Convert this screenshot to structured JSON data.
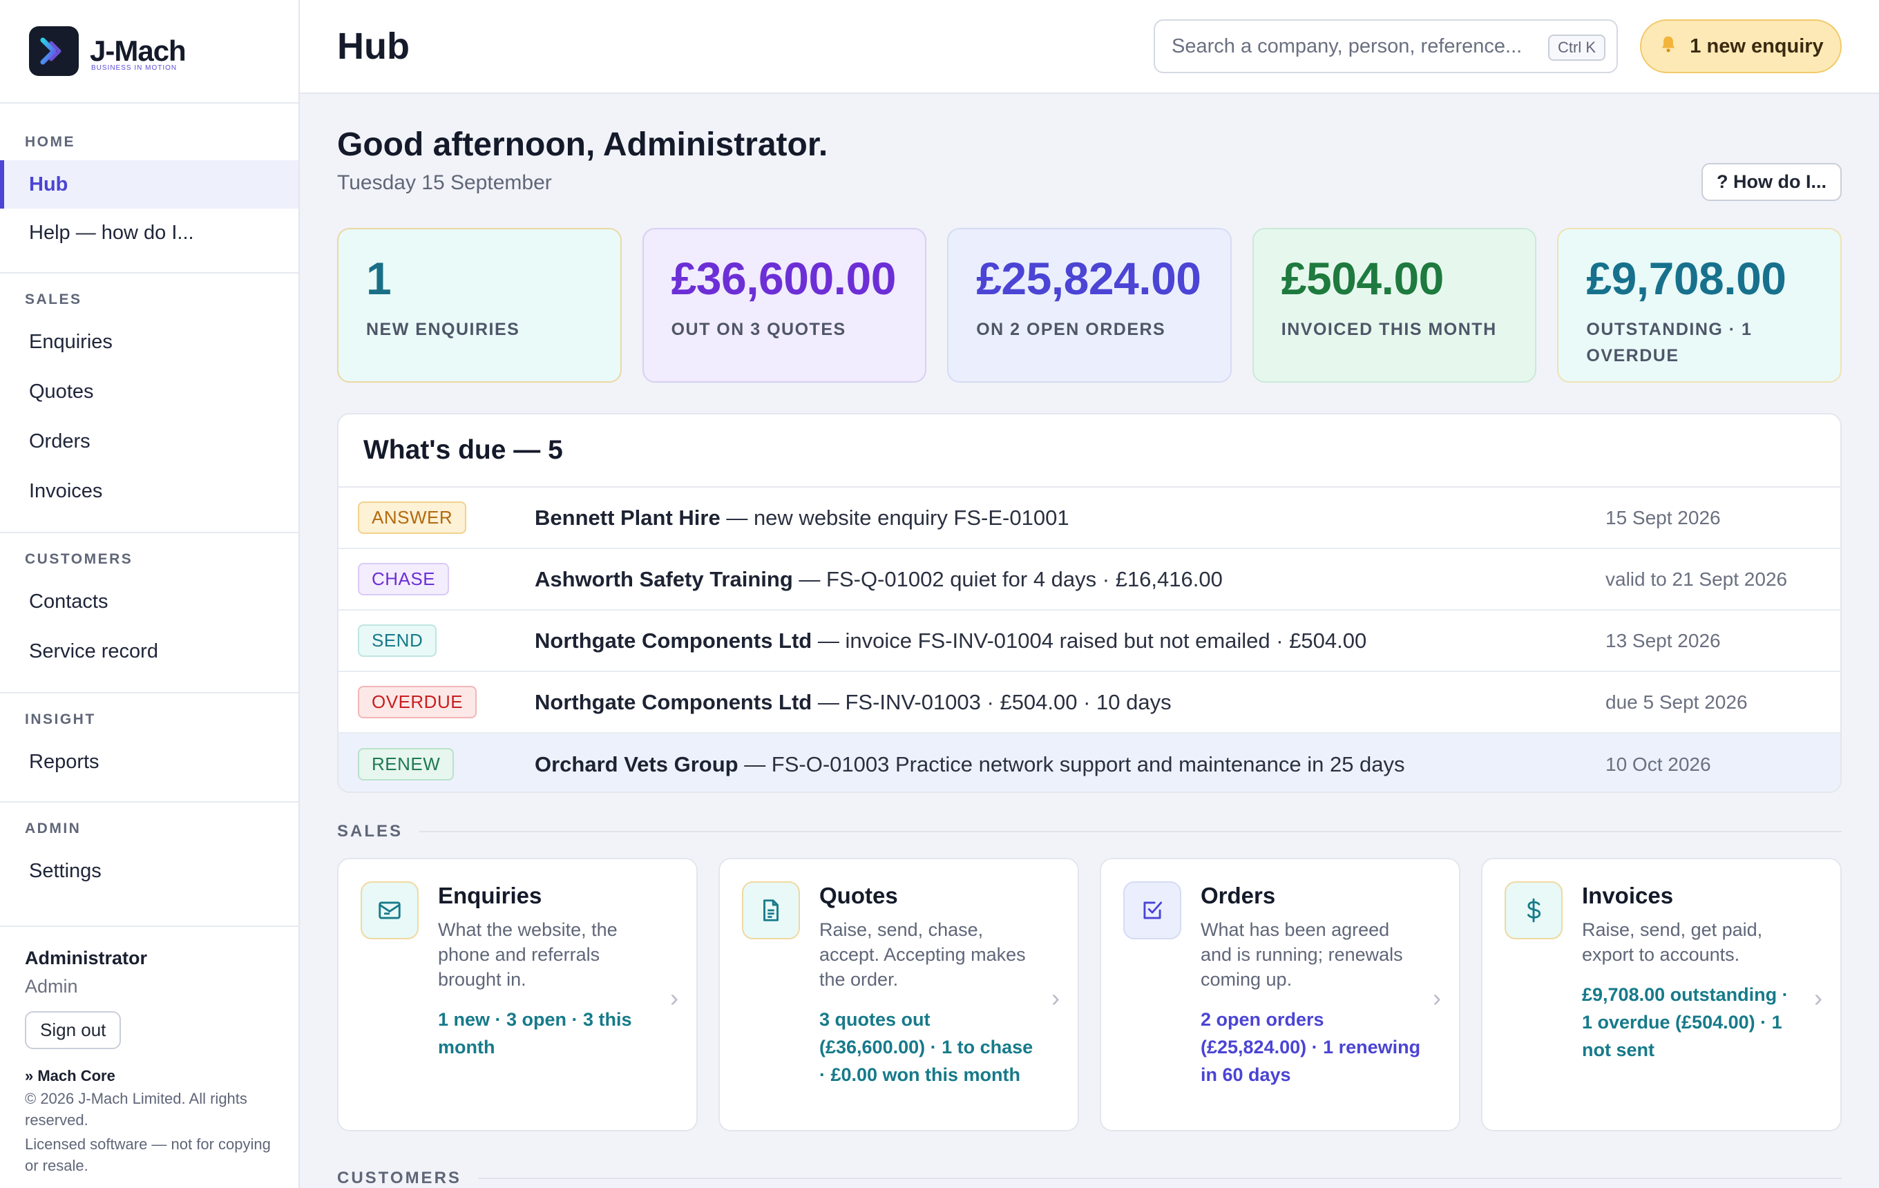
{
  "brand": {
    "name": "J-Mach",
    "tagline": "BUSINESS IN MOTION"
  },
  "sidebar": {
    "sections": [
      {
        "heading": "HOME",
        "items": [
          "Hub",
          "Help — how do I..."
        ]
      },
      {
        "heading": "SALES",
        "items": [
          "Enquiries",
          "Quotes",
          "Orders",
          "Invoices"
        ]
      },
      {
        "heading": "CUSTOMERS",
        "items": [
          "Contacts",
          "Service record"
        ]
      },
      {
        "heading": "INSIGHT",
        "items": [
          "Reports"
        ]
      },
      {
        "heading": "ADMIN",
        "items": [
          "Settings"
        ]
      }
    ],
    "active": "Hub"
  },
  "user": {
    "name": "Administrator",
    "role": "Admin",
    "signout_label": "Sign out",
    "product": "» Mach Core",
    "legal_1": "© 2026 J-Mach Limited. All rights reserved.",
    "legal_2": "Licensed software — not for copying or resale."
  },
  "header": {
    "title": "Hub",
    "search_placeholder": "Search a company, person, reference...",
    "search_shortcut": "Ctrl K",
    "alert_label": "1 new enquiry",
    "alert_icon": "bell-icon"
  },
  "greeting": {
    "text": "Good afternoon, Administrator.",
    "date": "Tuesday 15 September",
    "help_button": "? How do I..."
  },
  "stats": [
    {
      "value": "1",
      "label": "NEW ENQUIRIES"
    },
    {
      "value": "£36,600.00",
      "label": "OUT ON 3 QUOTES"
    },
    {
      "value": "£25,824.00",
      "label": "ON 2 OPEN ORDERS"
    },
    {
      "value": "£504.00",
      "label": "INVOICED THIS MONTH"
    },
    {
      "value": "£9,708.00",
      "label": "OUTSTANDING · 1 OVERDUE"
    }
  ],
  "due": {
    "title": "What's due — 5",
    "rows": [
      {
        "tag": "ANSWER",
        "company": "Bennett Plant Hire",
        "detail": " — new website enquiry FS-E-01001",
        "date": "15 Sept 2026"
      },
      {
        "tag": "CHASE",
        "company": "Ashworth Safety Training",
        "detail": " — FS-Q-01002 quiet for 4 days · £16,416.00",
        "date": "valid to 21 Sept 2026"
      },
      {
        "tag": "SEND",
        "company": "Northgate Components Ltd",
        "detail": " — invoice FS-INV-01004 raised but not emailed · £504.00",
        "date": "13 Sept 2026"
      },
      {
        "tag": "OVERDUE",
        "company": "Northgate Components Ltd",
        "detail": " — FS-INV-01003 · £504.00 · 10 days",
        "date": "due 5 Sept 2026"
      },
      {
        "tag": "RENEW",
        "company": "Orchard Vets Group",
        "detail": " — FS-O-01003 Practice network support and maintenance in 25 days",
        "date": "10 Oct 2026"
      }
    ]
  },
  "sales": {
    "heading": "SALES",
    "cards": [
      {
        "title": "Enquiries",
        "desc": "What the website, the phone and referrals brought in.",
        "stat": "1 new · 3 open · 3 this month",
        "icon": "mail-icon"
      },
      {
        "title": "Quotes",
        "desc": "Raise, send, chase, accept. Accepting makes the order.",
        "stat": "3 quotes out (£36,600.00) · 1 to chase · £0.00 won this month",
        "icon": "document-icon"
      },
      {
        "title": "Orders",
        "desc": "What has been agreed and is running; renewals coming up.",
        "stat": "2 open orders (£25,824.00) · 1 renewing in 60 days",
        "icon": "checkbox-icon"
      },
      {
        "title": "Invoices",
        "desc": "Raise, send, get paid, export to accounts.",
        "stat": "£9,708.00 outstanding · 1 overdue (£504.00) · 1 not sent",
        "icon": "dollar-icon"
      }
    ]
  },
  "customers": {
    "heading": "CUSTOMERS"
  }
}
